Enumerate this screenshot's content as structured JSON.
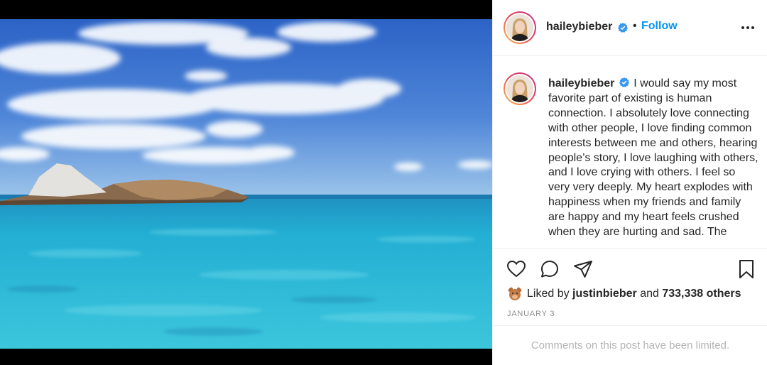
{
  "post": {
    "username": "haileybieber",
    "follow_label": "Follow",
    "separator": "•",
    "caption": "I would say my most favorite part of existing is human connection. I absolutely love connecting with other people, I love finding common interests between me and others, hearing people’s story, I love laughing with others, and I love crying with others. I feel so very very deeply. My heart explodes with happiness when my friends and family are happy and my heart feels crushed when they are hurting and sad. The",
    "liked_by_prefix": "Liked by",
    "liked_by_user": "justinbieber",
    "liked_by_and": "and",
    "liked_by_count": "733,338 others",
    "date": "JANUARY 3",
    "comments_notice": "Comments on this post have been limited."
  },
  "icons": {
    "verified": "verified-badge-icon",
    "more": "more-options-icon",
    "like": "heart-icon",
    "comment": "comment-icon",
    "share": "paper-plane-icon",
    "save": "bookmark-icon"
  },
  "colors": {
    "link_blue": "#0095f6",
    "text": "#262626",
    "muted": "#8e8e8e",
    "verified": "#3897f0",
    "story_ring_start": "#f9c64a",
    "story_ring_end": "#c52f87"
  }
}
